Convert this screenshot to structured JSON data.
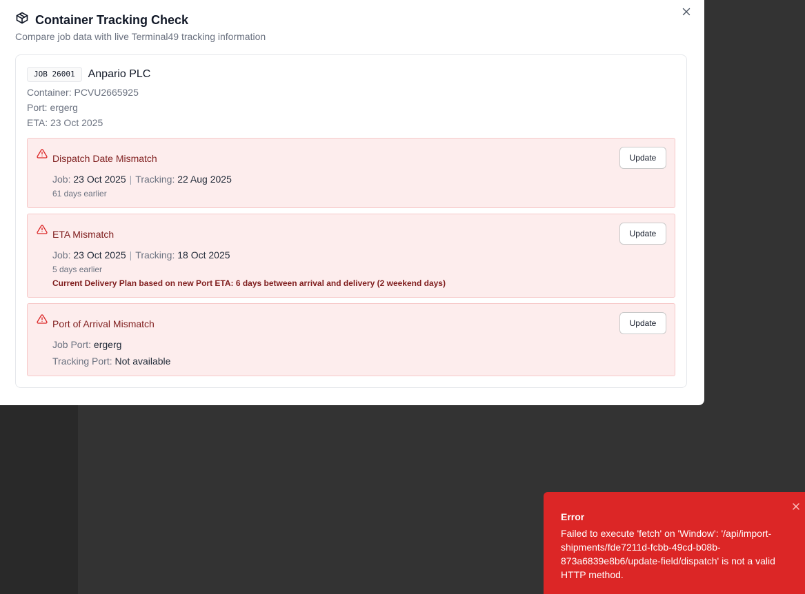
{
  "modal": {
    "title": "Container Tracking Check",
    "subtitle": "Compare job data with live Terminal49 tracking information",
    "close_icon": "close-icon"
  },
  "job": {
    "badge": "JOB 26001",
    "company": "Anpario PLC",
    "container": "Container: PCVU2665925",
    "port": "Port: ergerg",
    "eta": "ETA: 23 Oct 2025"
  },
  "alerts": [
    {
      "title": "Dispatch Date Mismatch",
      "job_label": "Job:",
      "job_value": "23 Oct 2025",
      "tracking_label": "Tracking:",
      "tracking_value": "22 Aug 2025",
      "note": "61 days earlier",
      "button": "Update"
    },
    {
      "title": "ETA Mismatch",
      "job_label": "Job:",
      "job_value": "23 Oct 2025",
      "tracking_label": "Tracking:",
      "tracking_value": "18 Oct 2025",
      "note": "5 days earlier",
      "plan": "Current Delivery Plan based on new Port ETA: 6 days between arrival and delivery (2 weekend days)",
      "button": "Update"
    },
    {
      "title": "Port of Arrival Mismatch",
      "job_port_label": "Job Port:",
      "job_port_value": "ergerg",
      "tracking_port_label": "Tracking Port:",
      "tracking_port_value": "Not available",
      "button": "Update"
    }
  ],
  "toast": {
    "title": "Error",
    "message": "Failed to execute 'fetch' on 'Window': '/api/import-shipments/fde7211d-fcbb-49cd-b08b-873a6839e8b6/update-field/dispatch' is not a valid HTTP method."
  },
  "colors": {
    "alert_bg": "#fdeded",
    "alert_border": "#f6c7c7",
    "alert_title": "#7f1d1d",
    "warning_icon": "#dc2626",
    "toast_bg": "#dc2626"
  }
}
